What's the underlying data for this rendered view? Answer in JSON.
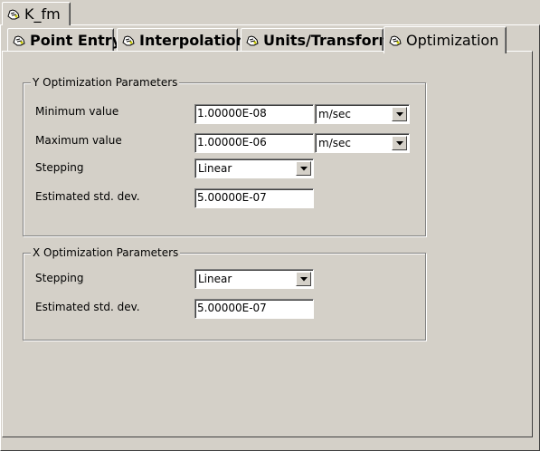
{
  "window_tab": {
    "label": "K_fm",
    "icon": "hand-icon"
  },
  "tabs": [
    {
      "label": "Point Entry",
      "icon": "hand-icon",
      "selected": false
    },
    {
      "label": "Interpolation",
      "icon": "hand-icon",
      "selected": false
    },
    {
      "label": "Units/Transform",
      "icon": "hand-icon",
      "selected": false
    },
    {
      "label": "Optimization",
      "icon": "hand-icon",
      "selected": true
    }
  ],
  "y_group": {
    "title": "Y Optimization Parameters",
    "min_label": "Minimum value",
    "min_value": "1.00000E-08",
    "min_unit": "m/sec",
    "max_label": "Maximum value",
    "max_value": "1.00000E-06",
    "max_unit": "m/sec",
    "stepping_label": "Stepping",
    "stepping_value": "Linear",
    "stddev_label": "Estimated std. dev.",
    "stddev_value": "5.00000E-07"
  },
  "x_group": {
    "title": "X Optimization Parameters",
    "stepping_label": "Stepping",
    "stepping_value": "Linear",
    "stddev_label": "Estimated std. dev.",
    "stddev_value": "5.00000E-07"
  }
}
